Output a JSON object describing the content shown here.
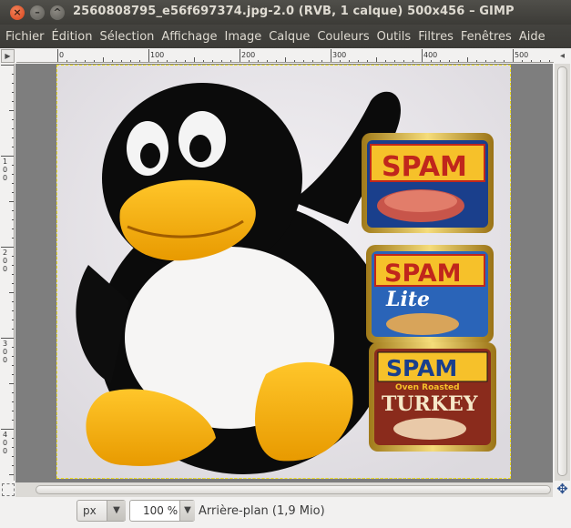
{
  "window": {
    "title": "2560808795_e56f697374.jpg-2.0 (RVB, 1 calque) 500x456 – GIMP",
    "close_glyph": "×",
    "minimize_glyph": "–",
    "maximize_glyph": "^"
  },
  "menubar": [
    "Fichier",
    "Édition",
    "Sélection",
    "Affichage",
    "Image",
    "Calque",
    "Couleurs",
    "Outils",
    "Filtres",
    "Fenêtres",
    "Aide"
  ],
  "rulers": {
    "horizontal_labels": [
      "0",
      "100",
      "200",
      "300",
      "400",
      "500"
    ],
    "vertical_labels": [
      "100",
      "200",
      "300",
      "400"
    ]
  },
  "image": {
    "spam_cans": [
      {
        "brand": "SPAM",
        "variant": "",
        "color": "#1a3f8c"
      },
      {
        "brand": "SPAM",
        "variant": "Lite",
        "color": "#2a64b8"
      },
      {
        "brand": "SPAM",
        "variant": "TURKEY",
        "tagline": "Oven Roasted",
        "color": "#8a2b1c"
      }
    ]
  },
  "statusbar": {
    "unit": "px",
    "zoom": "100 %",
    "status": "Arrière-plan (1,9 Mio)"
  },
  "icons": {
    "navigate": "✥",
    "dropdown": "▼"
  }
}
